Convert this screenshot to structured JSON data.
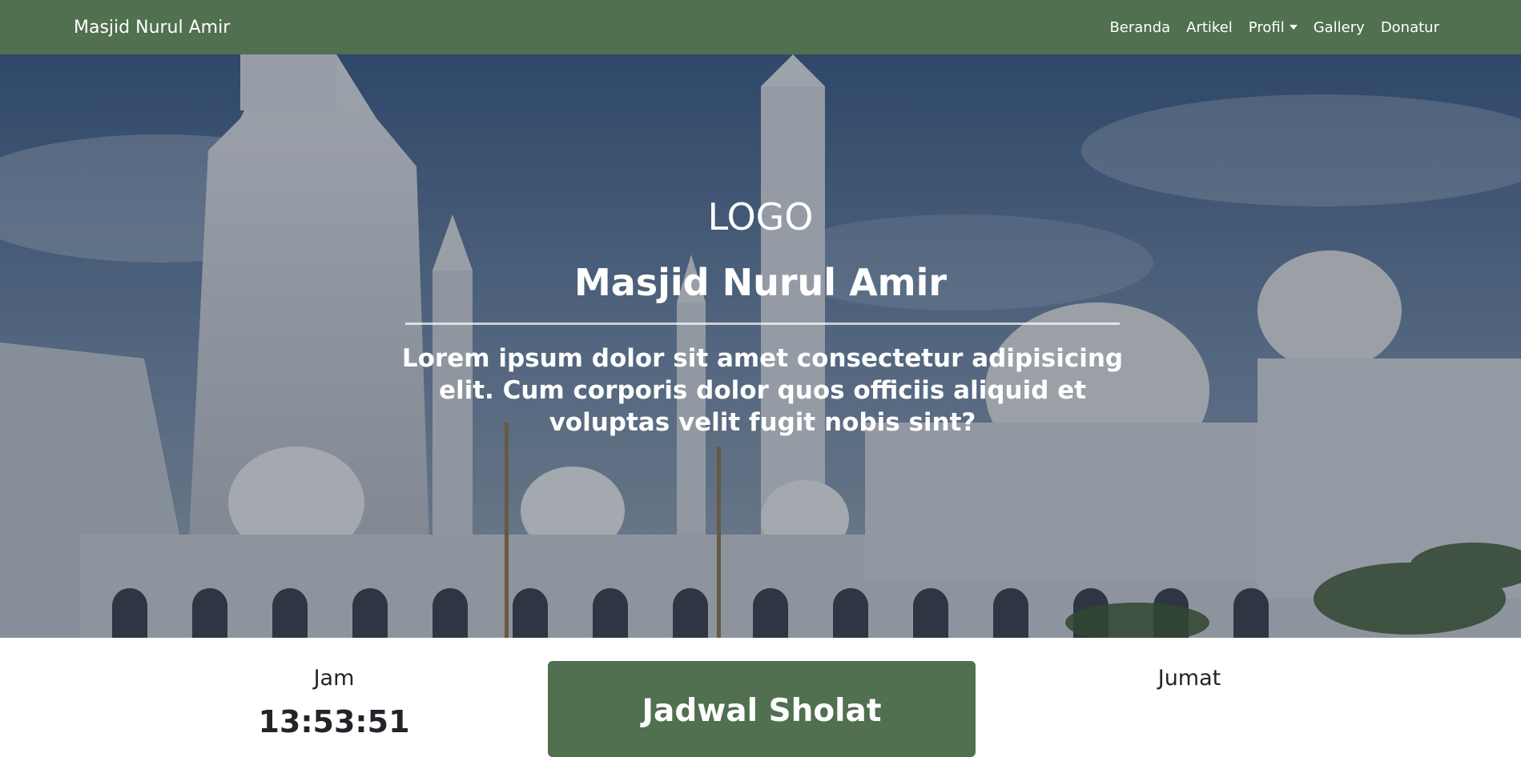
{
  "navbar": {
    "brand": "Masjid Nurul Amir",
    "items": [
      {
        "label": "Beranda"
      },
      {
        "label": "Artikel"
      },
      {
        "label": "Profil",
        "dropdown": true
      },
      {
        "label": "Gallery"
      },
      {
        "label": "Donatur"
      }
    ],
    "background": "#507050"
  },
  "hero": {
    "logo": "LOGO",
    "title": "Masjid Nurul Amir",
    "lead": "Lorem ipsum dolor sit amet consectetur adipisicing elit. Cum corporis dolor quos officiis aliquid et voluptas velit fugit nobis sint?"
  },
  "info": {
    "jam_label": "Jam",
    "jam_time": "13:53:51",
    "jadwal_title": "Jadwal Sholat",
    "day": "Jumat"
  },
  "colors": {
    "accent": "#507050",
    "text_dark": "#212529"
  }
}
